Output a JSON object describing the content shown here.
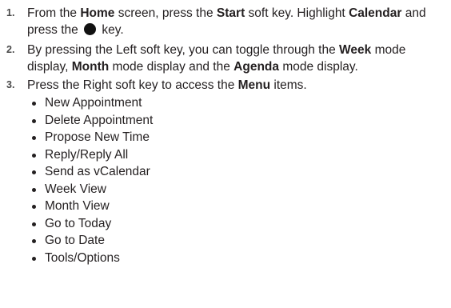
{
  "steps": [
    {
      "number": "1.",
      "parts": {
        "t1": "From the ",
        "b1": "Home",
        "t2": " screen, press the ",
        "b2": "Start",
        "t3": " soft key. Highlight ",
        "b3": "Calendar",
        "t4": " and press the ",
        "t5": " key."
      },
      "icon": "center-key-icon"
    },
    {
      "number": "2.",
      "parts": {
        "t1": "By pressing the Left soft key, you can toggle through the ",
        "b1": "Week",
        "t2": " mode display, ",
        "b2": "Month",
        "t3": " mode display and the ",
        "b3": "Agenda",
        "t4": " mode display."
      }
    },
    {
      "number": "3.",
      "parts": {
        "t1": "Press the Right soft key to access the ",
        "b1": "Menu",
        "t2": " items."
      }
    }
  ],
  "menu_items": [
    "New Appointment",
    "Delete Appointment",
    "Propose New Time",
    "Reply/Reply All",
    "Send as vCalendar",
    "Week View",
    "Month View",
    "Go to Today",
    "Go to Date",
    "Tools/Options"
  ]
}
